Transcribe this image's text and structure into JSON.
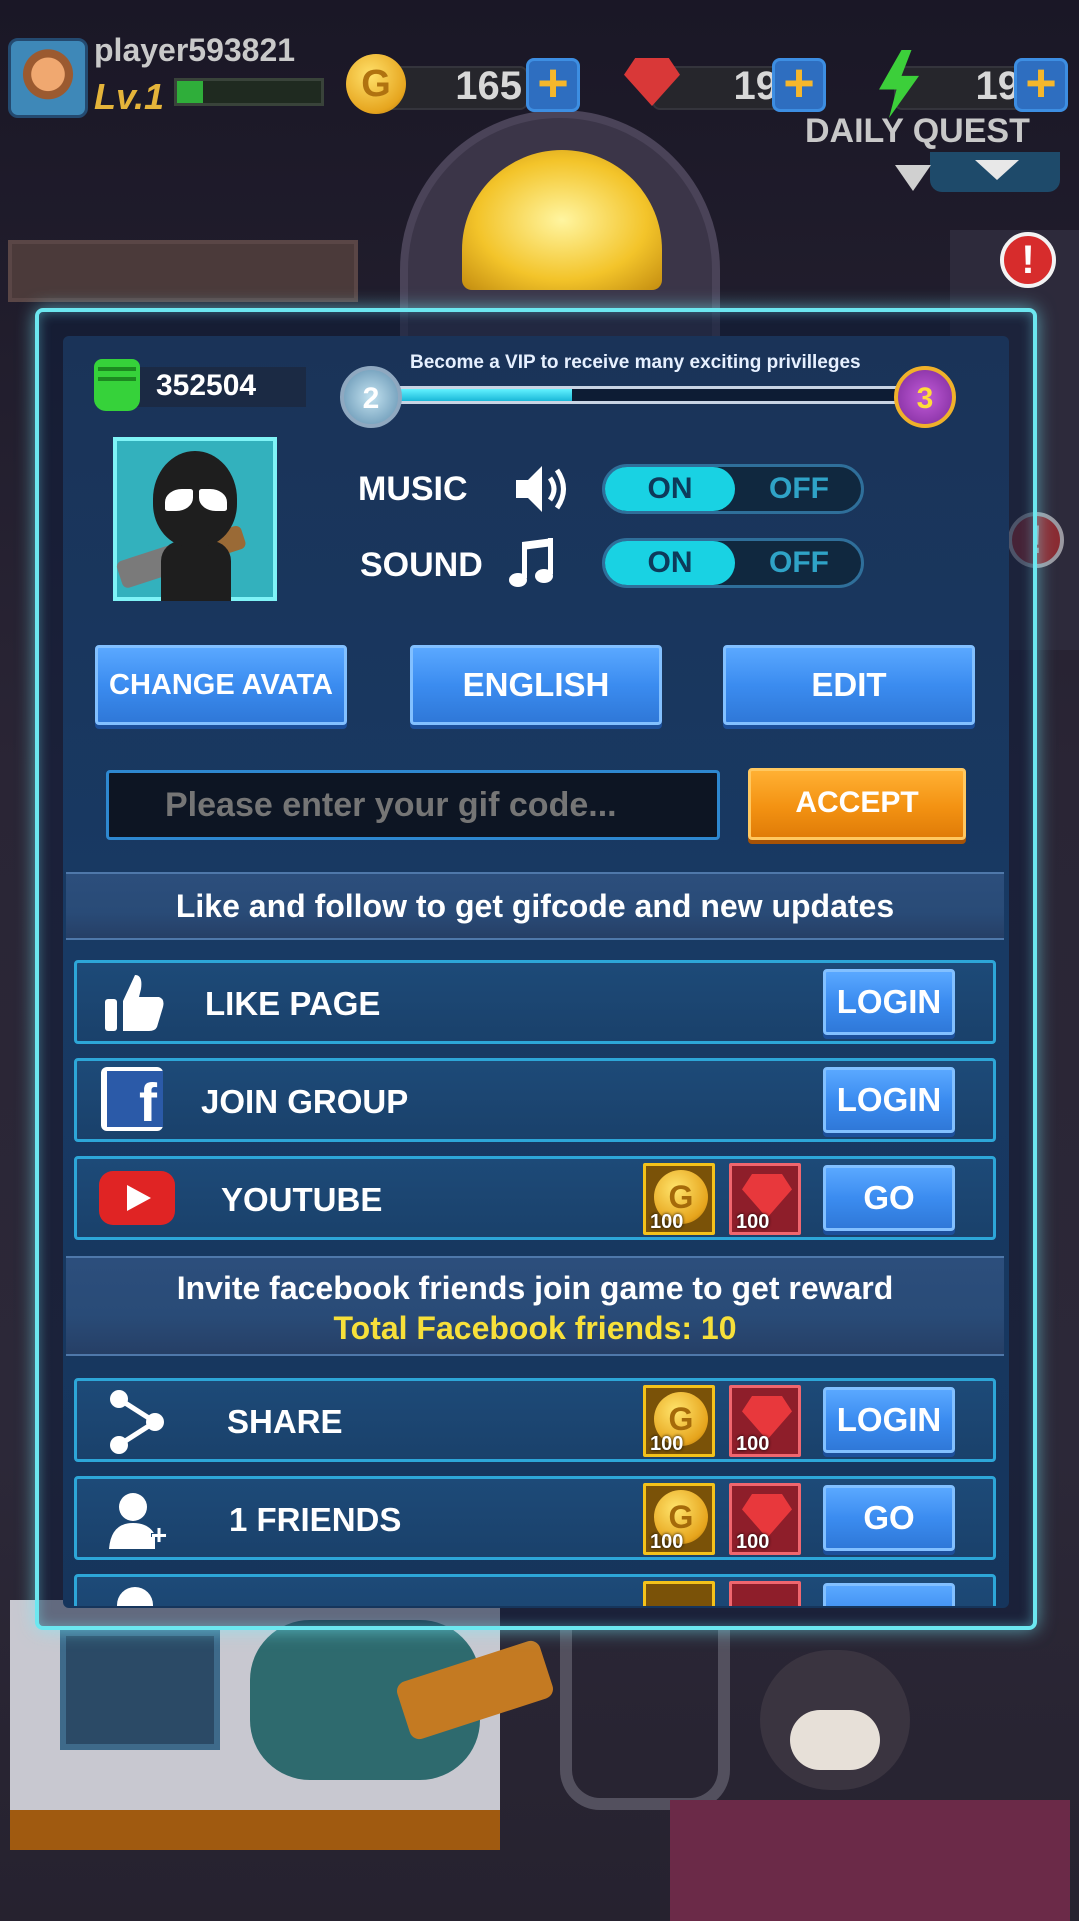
{
  "hud": {
    "player_name": "player593821",
    "level": "Lv.1",
    "xp_fraction": 0.18,
    "coins": "165",
    "gems": "19",
    "energy": "19",
    "daily_quest": "DAILY QUEST"
  },
  "profile": {
    "power": "352504",
    "vip_text": "Become a VIP to receive many exciting privilleges",
    "vip_current": "2",
    "vip_next": "3",
    "vip_progress": 0.36,
    "music_label": "MUSIC",
    "sound_label": "SOUND",
    "music_on": "ON",
    "music_off": "OFF",
    "sound_on": "ON",
    "sound_off": "OFF"
  },
  "buttons": {
    "change_avatar": "CHANGE AVATA",
    "language": "ENGLISH",
    "edit": "EDIT",
    "accept": "ACCEPT"
  },
  "giftcode": {
    "placeholder": "Please enter your gif code..."
  },
  "follow_section": {
    "title": "Like and follow to get gifcode and new updates",
    "rows": [
      {
        "label": "LIKE PAGE",
        "button": "LOGIN"
      },
      {
        "label": "JOIN GROUP",
        "button": "LOGIN"
      },
      {
        "label": "YOUTUBE",
        "button": "GO",
        "coin_reward": "100",
        "gem_reward": "100"
      }
    ]
  },
  "invite_section": {
    "title": "Invite facebook friends join game to get reward",
    "subtitle": "Total Facebook friends: 10",
    "rows": [
      {
        "label": "SHARE",
        "button": "LOGIN",
        "coin_reward": "100",
        "gem_reward": "100"
      },
      {
        "label": "1 FRIENDS",
        "button": "GO",
        "coin_reward": "100",
        "gem_reward": "100"
      }
    ]
  },
  "colors": {
    "accent_cyan": "#19d2e3",
    "button_blue": "#3b8cf0",
    "button_orange": "#f39212",
    "highlight_yellow": "#f7e03a"
  }
}
